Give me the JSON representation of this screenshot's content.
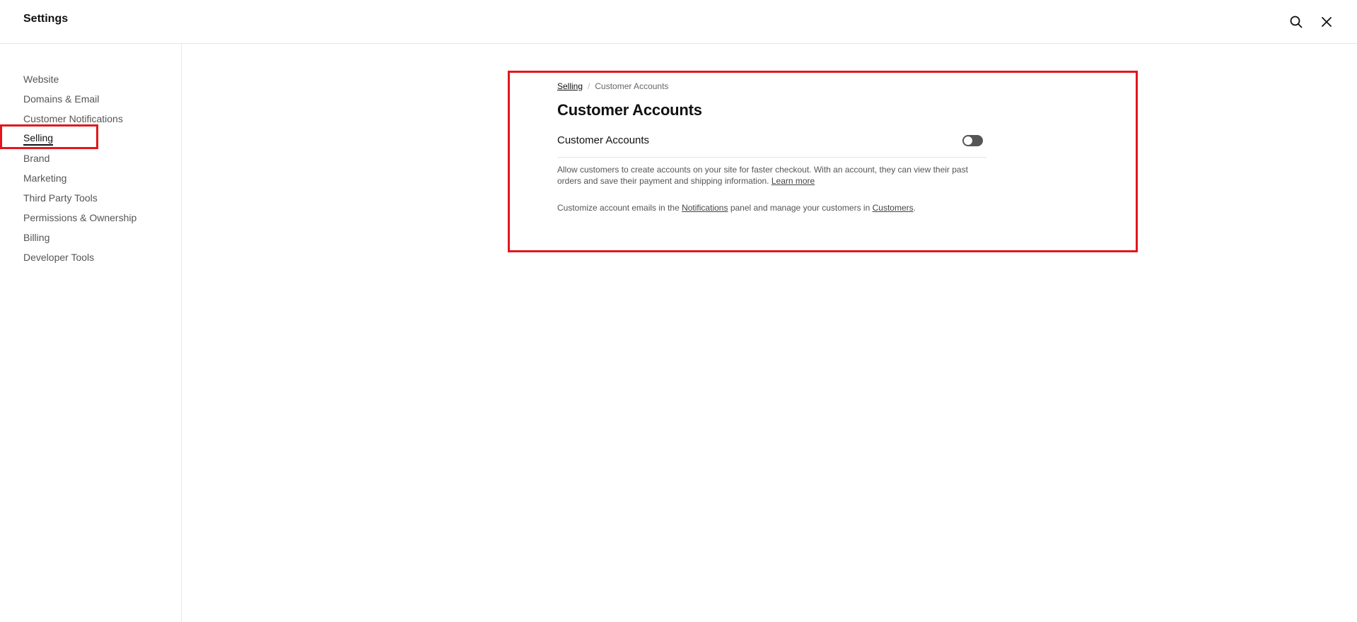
{
  "header": {
    "title": "Settings",
    "search_icon": "search-icon",
    "close_icon": "close-icon"
  },
  "sidebar": {
    "items": [
      {
        "label": "Website"
      },
      {
        "label": "Domains & Email"
      },
      {
        "label": "Customer Notifications"
      },
      {
        "label": "Selling",
        "active": true
      },
      {
        "label": "Brand"
      },
      {
        "label": "Marketing"
      },
      {
        "label": "Third Party Tools"
      },
      {
        "label": "Permissions & Ownership"
      },
      {
        "label": "Billing"
      },
      {
        "label": "Developer Tools"
      }
    ]
  },
  "main": {
    "breadcrumb": {
      "parent": "Selling",
      "separator": "/",
      "current": "Customer Accounts"
    },
    "title": "Customer Accounts",
    "setting": {
      "label": "Customer Accounts",
      "toggle_on": false
    },
    "description": {
      "text": "Allow customers to create accounts on your site for faster checkout. With an account, they can view their past orders and save their payment and shipping information.",
      "link": "Learn more"
    },
    "note": {
      "prefix": "Customize account emails in the",
      "link1": "Notifications",
      "middle": "panel and manage your customers in",
      "link2": "Customers",
      "suffix": "."
    }
  },
  "colors": {
    "annotation": "#e3161d",
    "toggle_off": "#555555"
  }
}
